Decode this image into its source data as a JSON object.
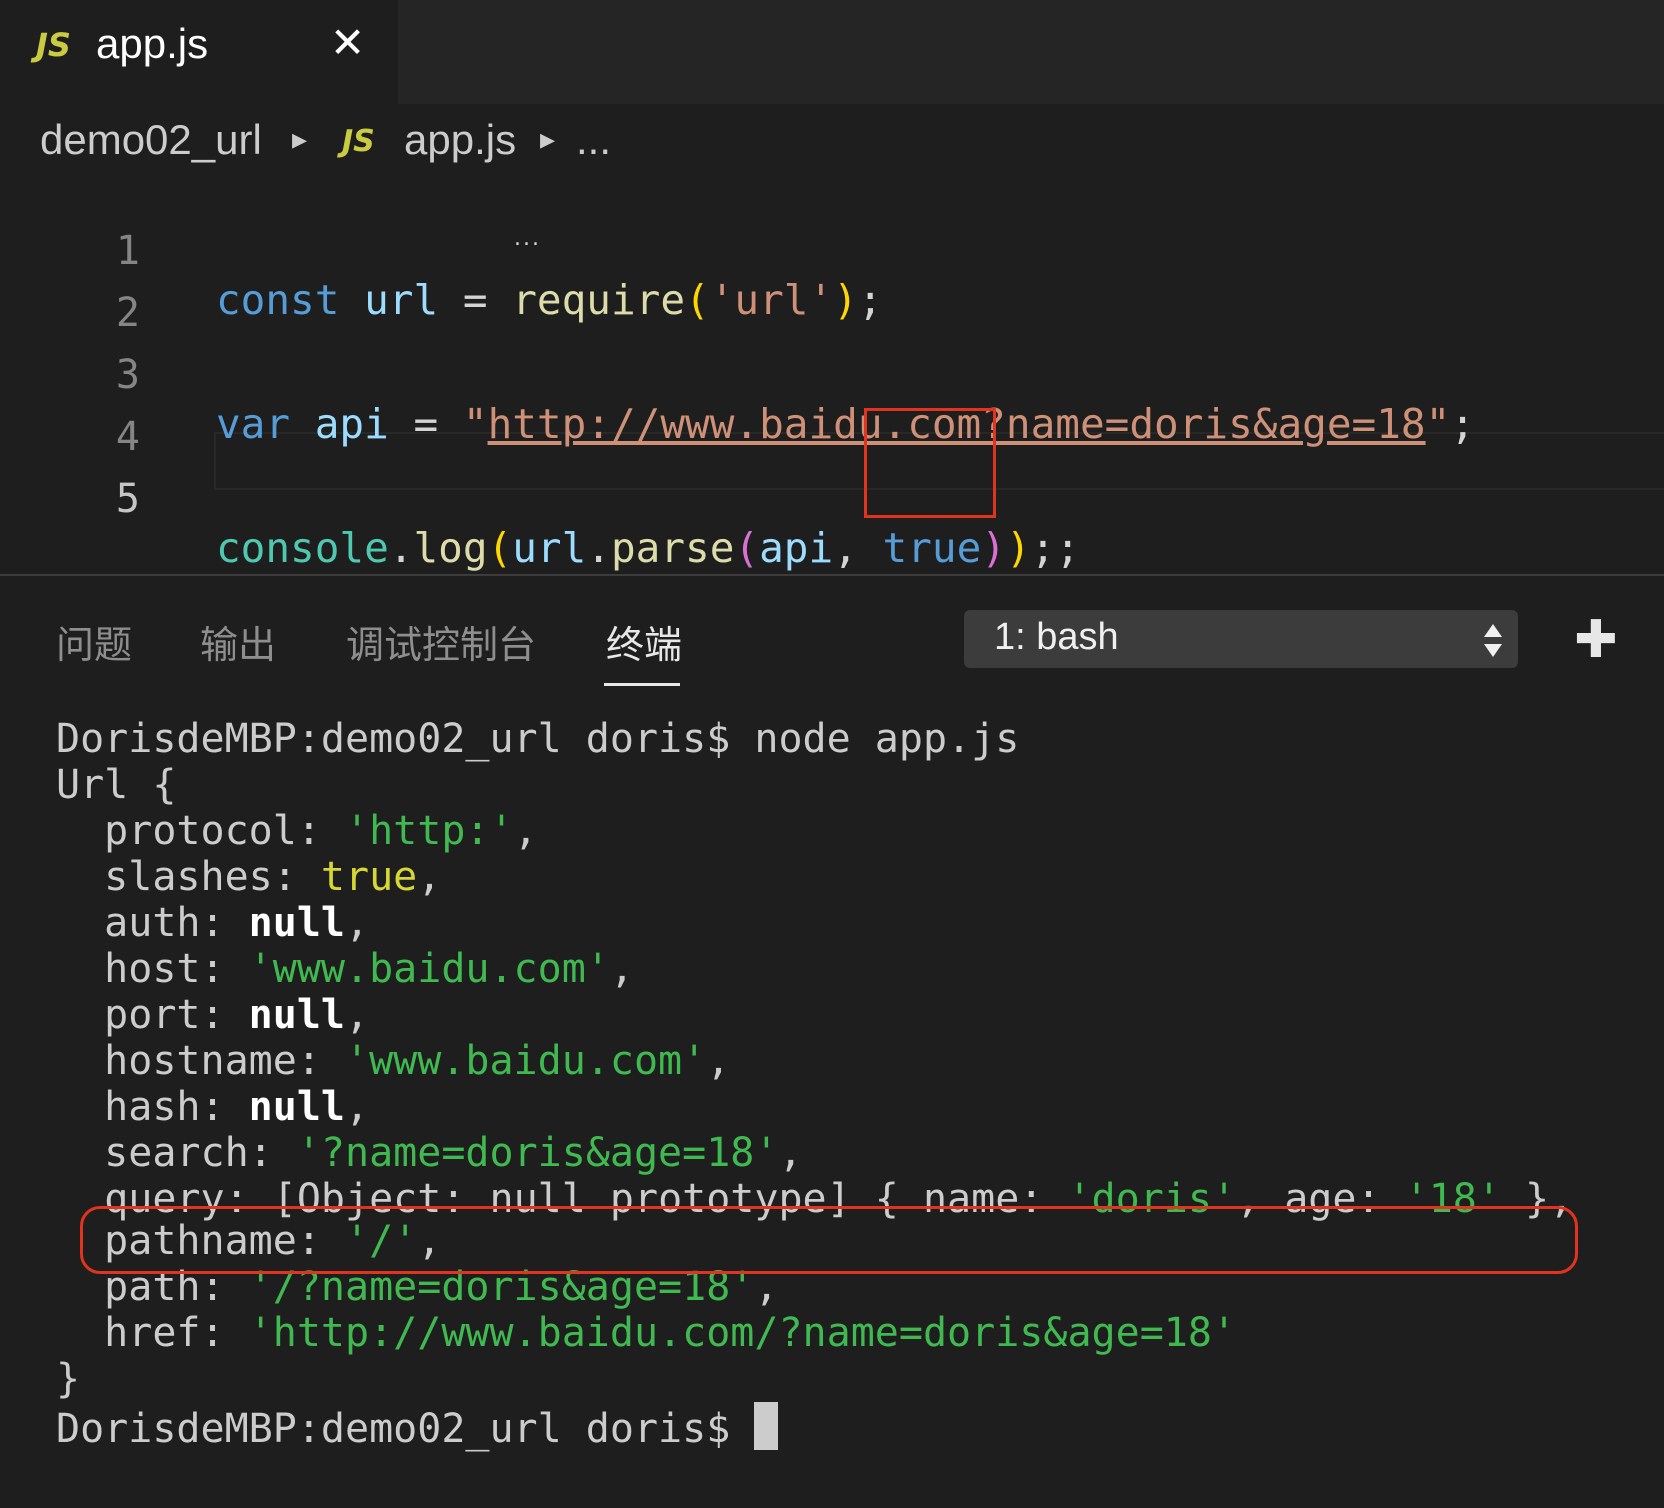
{
  "tab": {
    "badge": "JS",
    "title": "app.js",
    "close": "✕"
  },
  "breadcrumb": {
    "folder": "demo02_url",
    "badge": "JS",
    "file": "app.js",
    "more": "..."
  },
  "editor": {
    "line_numbers": [
      "1",
      "2",
      "3",
      "4",
      "5"
    ],
    "line1": {
      "kw": "const",
      "var": "url",
      "eq": " = ",
      "fn": "require",
      "open": "(",
      "str": "'url'",
      "close": ")",
      "end": ";"
    },
    "line3": {
      "kw": "var",
      "var": "api",
      "eq": " = ",
      "q1": "\"",
      "url": "http://www.baidu.com?name=doris&age=18",
      "q2": "\"",
      "end": ";"
    },
    "line5": {
      "cls": "console",
      "dot1": ".",
      "fn1": "log",
      "p1o": "(",
      "var1": "url",
      "dot2": ".",
      "fn2": "parse",
      "p2o": "(",
      "var2": "api",
      "comma": ", ",
      "bool": "true",
      "p2c": ")",
      "p1c": ")",
      "end": ";;"
    },
    "dots": "..."
  },
  "panel": {
    "tabs": [
      "问题",
      "输出",
      "调试控制台",
      "终端"
    ],
    "active_tab": "终端",
    "terminal_select": "1: bash",
    "add_label": "✚"
  },
  "terminal": {
    "prompt": "DorisdeMBP:demo02_url doris$",
    "command": " node app.js",
    "open": "Url {",
    "fields": [
      {
        "key": "  protocol: ",
        "val": "'http:'",
        "type": "str",
        "tail": ","
      },
      {
        "key": "  slashes: ",
        "val": "true",
        "type": "bool",
        "tail": ","
      },
      {
        "key": "  auth: ",
        "val": "null",
        "type": "null",
        "tail": ","
      },
      {
        "key": "  host: ",
        "val": "'www.baidu.com'",
        "type": "str",
        "tail": ","
      },
      {
        "key": "  port: ",
        "val": "null",
        "type": "null",
        "tail": ","
      },
      {
        "key": "  hostname: ",
        "val": "'www.baidu.com'",
        "type": "str",
        "tail": ","
      },
      {
        "key": "  hash: ",
        "val": "null",
        "type": "null",
        "tail": ","
      },
      {
        "key": "  search: ",
        "val": "'?name=doris&age=18'",
        "type": "str",
        "tail": ","
      }
    ],
    "query": {
      "key": "  query: ",
      "pre": "[Object: null prototype] { name: ",
      "name": "'doris'",
      "mid": ", age: ",
      "age": "'18'",
      "post": " },"
    },
    "fields2": [
      {
        "key": "  pathname: ",
        "val": "'/'",
        "type": "str",
        "tail": ","
      },
      {
        "key": "  path: ",
        "val": "'/?name=doris&age=18'",
        "type": "str",
        "tail": ","
      },
      {
        "key": "  href: ",
        "val": "'http://www.baidu.com/?name=doris&age=18'",
        "type": "str",
        "tail": ""
      }
    ],
    "close": "}",
    "prompt2": "DorisdeMBP:demo02_url doris$ "
  },
  "colors": {
    "highlight": "#e0341f",
    "string_green": "#3fb950",
    "keyword": "#569cd6"
  }
}
